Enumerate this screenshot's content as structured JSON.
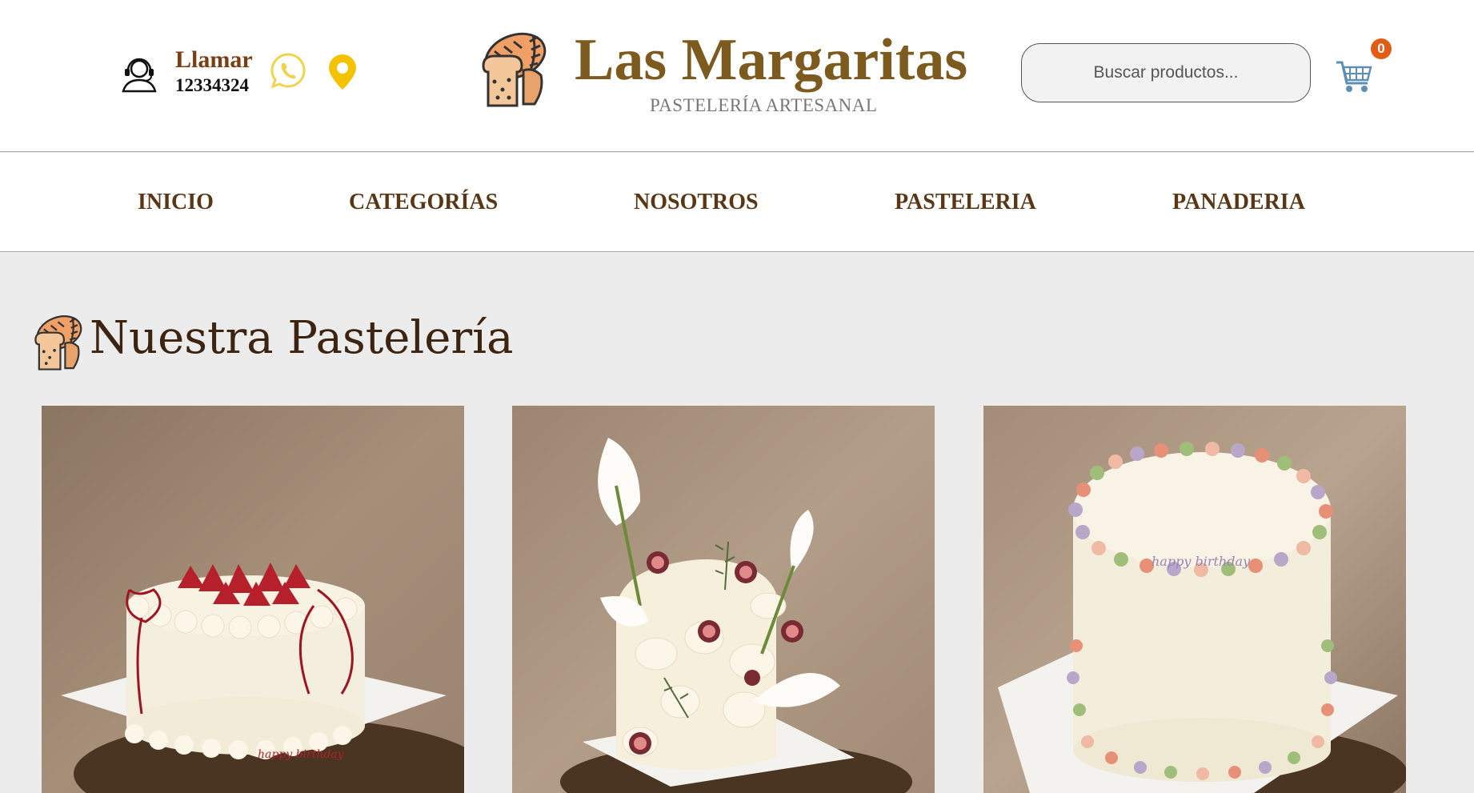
{
  "header": {
    "call_label": "Llamar",
    "call_number": "12334324",
    "icons": [
      "call-center-icon",
      "whatsapp-icon",
      "location-pin-icon",
      "bakery-logo-icon",
      "shopping-cart-icon"
    ],
    "brand_title": "Las Margaritas",
    "brand_subtitle": "PASTELERÍA ARTESANAL",
    "search_placeholder": "Buscar productos...",
    "cart_count": "0"
  },
  "nav": {
    "items": [
      {
        "label": "INICIO"
      },
      {
        "label": "CATEGORÍAS"
      },
      {
        "label": "NOSOTROS"
      },
      {
        "label": "PASTELERIA"
      },
      {
        "label": "PANADERIA"
      }
    ]
  },
  "section": {
    "title": "Nuestra Pastelería"
  },
  "products": [
    {
      "image": "strawberry-cake-photo",
      "cake_inscription": "happy birthday"
    },
    {
      "image": "calla-lily-fig-cake-photo"
    },
    {
      "image": "floral-piped-cake-photo",
      "cake_inscription": "happy birthday"
    }
  ],
  "colors": {
    "brand": "#7d5b1e",
    "nav_text": "#5a3614",
    "accent_badge": "#e15d16",
    "pin": "#f5c200",
    "whatsapp": "#f2d24b",
    "page_bg": "#ececec"
  }
}
